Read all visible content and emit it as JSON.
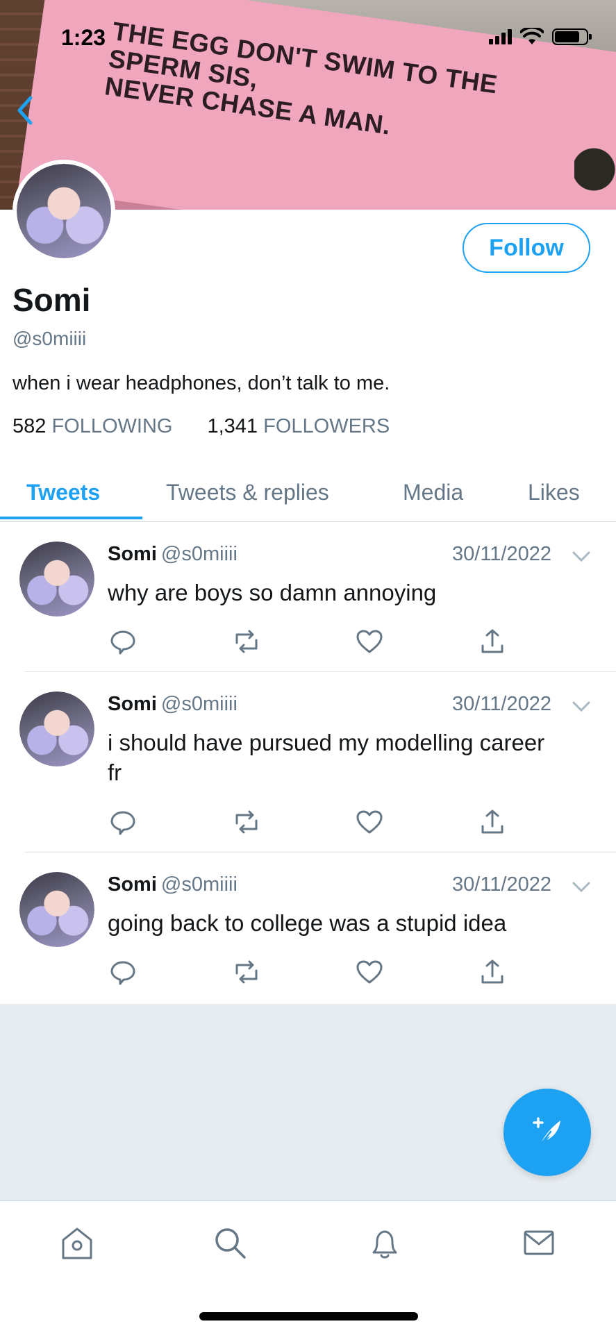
{
  "status_bar": {
    "time": "1:23"
  },
  "banner": {
    "billboard_line1": "THE EGG DON'T SWIM TO THE SPERM SIS,",
    "billboard_line2": "NEVER CHASE A MAN."
  },
  "profile": {
    "name": "Somi",
    "handle": "@s0miiii",
    "bio": "when i wear headphones, don’t talk to me.",
    "following_count": "582",
    "following_label": "FOLLOWING",
    "followers_count": "1,341",
    "followers_label": "FOLLOWERS",
    "follow_button": "Follow"
  },
  "tabs": [
    {
      "label": "Tweets",
      "active": true
    },
    {
      "label": "Tweets & replies",
      "active": false
    },
    {
      "label": "Media",
      "active": false
    },
    {
      "label": "Likes",
      "active": false
    }
  ],
  "tweets": [
    {
      "name": "Somi",
      "handle": "@s0miiii",
      "date": "30/11/2022",
      "text": "why are boys so damn annoying"
    },
    {
      "name": "Somi",
      "handle": "@s0miiii",
      "date": "30/11/2022",
      "text": "i should have pursued my modelling career fr"
    },
    {
      "name": "Somi",
      "handle": "@s0miiii",
      "date": "30/11/2022",
      "text": "going back to college was a stupid idea"
    }
  ],
  "icons": {
    "back": "chevron-left-icon",
    "reply": "reply-icon",
    "retweet": "retweet-icon",
    "like": "heart-icon",
    "share": "share-icon",
    "compose": "compose-tweet-icon",
    "nav": [
      "home-icon",
      "search-icon",
      "notifications-icon",
      "messages-icon"
    ]
  },
  "colors": {
    "accent": "#1da1f2",
    "muted": "#657786",
    "billboard": "#f0a6bd"
  }
}
